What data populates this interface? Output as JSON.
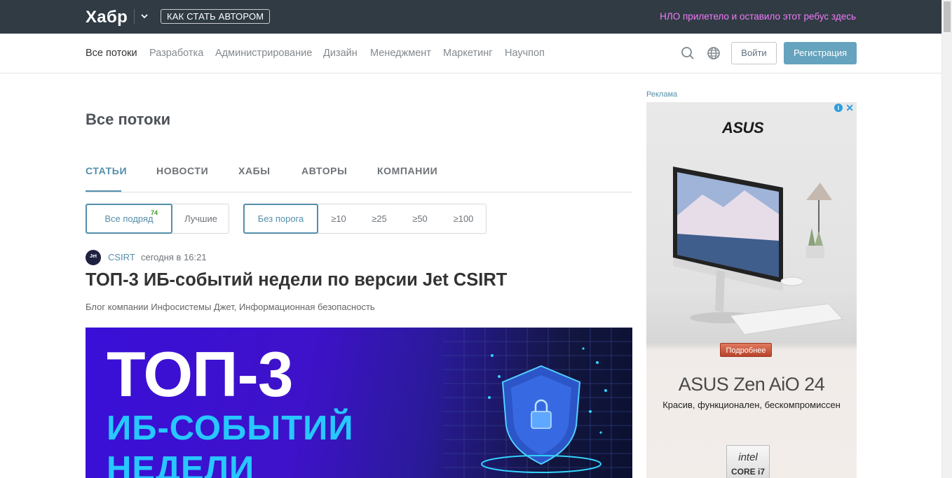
{
  "topbar": {
    "logo": "Хабр",
    "author_button": "КАК СТАТЬ АВТОРОМ",
    "ufo_link": "НЛО прилетело и оставило этот ребус здесь"
  },
  "nav": {
    "items": [
      {
        "label": "Все потоки",
        "active": true
      },
      {
        "label": "Разработка"
      },
      {
        "label": "Администрирование"
      },
      {
        "label": "Дизайн"
      },
      {
        "label": "Менеджмент"
      },
      {
        "label": "Маркетинг"
      },
      {
        "label": "Научпоп"
      }
    ],
    "search_icon": "search-icon",
    "language_icon": "globe-icon",
    "login": "Войти",
    "register": "Регистрация"
  },
  "main": {
    "title": "Все потоки",
    "tabs": [
      {
        "label": "СТАТЬИ",
        "active": true
      },
      {
        "label": "НОВОСТИ"
      },
      {
        "label": "ХАБЫ"
      },
      {
        "label": "АВТОРЫ"
      },
      {
        "label": "КОМПАНИИ"
      }
    ],
    "filters": {
      "order": [
        {
          "label": "Все подряд",
          "count": "74",
          "active": true
        },
        {
          "label": "Лучшие"
        }
      ],
      "threshold": [
        {
          "label": "Без порога",
          "active": true
        },
        {
          "label": "≥10"
        },
        {
          "label": "≥25"
        },
        {
          "label": "≥50"
        },
        {
          "label": "≥100"
        }
      ]
    },
    "post": {
      "author": "CSIRT",
      "avatar_mark": "Jet",
      "time": "сегодня в 16:21",
      "title": "ТОП-3 ИБ-событий недели по версии Jet CSIRT",
      "hubs": "Блог компании Инфосистемы Джет,  Информационная безопасность",
      "banner": {
        "line1": "ТОП-3",
        "line2": "ИБ-СОБЫТИЙ",
        "line3": "НЕДЕЛИ"
      }
    }
  },
  "ad": {
    "label": "Реклама",
    "brand": "ASUS",
    "more_button": "Подробнее",
    "product": "ASUS Zen AiO 24",
    "slogan": "Красив, функционален, бескомпромиссен",
    "badge_logo": "intel",
    "badge_text": "CORE i7",
    "info_icon": "info-icon",
    "close_icon": "close-icon"
  },
  "colors": {
    "topbar_bg": "#303b44",
    "accent": "#548eaa",
    "register_bg": "#65a3be",
    "ufo_link": "#ef7bf7",
    "count_green": "#3f9a2b"
  }
}
